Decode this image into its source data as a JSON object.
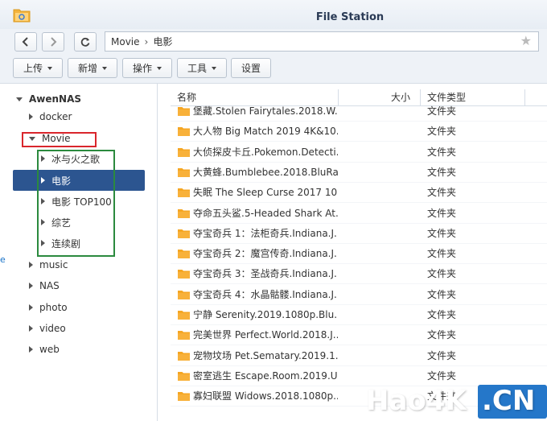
{
  "window": {
    "title": "File Station"
  },
  "nav": {
    "path": [
      "Movie",
      "电影"
    ]
  },
  "toolbar": {
    "upload": "上传",
    "create": "新增",
    "action": "操作",
    "tools": "工具",
    "settings": "设置"
  },
  "tree": {
    "root": "AwenNAS",
    "items": [
      {
        "label": "docker",
        "level": 1,
        "expanded": false
      },
      {
        "label": "Movie",
        "level": 1,
        "expanded": true
      },
      {
        "label": "冰与火之歌",
        "level": 2,
        "expanded": false
      },
      {
        "label": "电影",
        "level": 2,
        "expanded": false,
        "selected": true
      },
      {
        "label": "电影 TOP100",
        "level": 2,
        "expanded": false
      },
      {
        "label": "综艺",
        "level": 2,
        "expanded": false
      },
      {
        "label": "连续剧",
        "level": 2,
        "expanded": false
      },
      {
        "label": "music",
        "level": 1,
        "expanded": false
      },
      {
        "label": "NAS",
        "level": 1,
        "expanded": false
      },
      {
        "label": "photo",
        "level": 1,
        "expanded": false
      },
      {
        "label": "video",
        "level": 1,
        "expanded": false
      },
      {
        "label": "web",
        "level": 1,
        "expanded": false
      }
    ]
  },
  "files": {
    "columns": {
      "name": "名称",
      "size": "大小",
      "type": "文件类型"
    },
    "rows": [
      {
        "name": "堡藏.Stolen Fairytales.2018.W...",
        "type": "文件夹"
      },
      {
        "name": "大人物 Big Match 2019 4K&10...",
        "type": "文件夹"
      },
      {
        "name": "大侦探皮卡丘.Pokemon.Detecti...",
        "type": "文件夹"
      },
      {
        "name": "大黄蜂.Bumblebee.2018.BluRa...",
        "type": "文件夹"
      },
      {
        "name": "失眠 The Sleep Curse 2017 10...",
        "type": "文件夹"
      },
      {
        "name": "夺命五头鲨.5-Headed Shark At...",
        "type": "文件夹"
      },
      {
        "name": "夺宝奇兵 1：法柜奇兵.Indiana.J...",
        "type": "文件夹"
      },
      {
        "name": "夺宝奇兵 2：魔宫传奇.Indiana.J...",
        "type": "文件夹"
      },
      {
        "name": "夺宝奇兵 3：圣战奇兵.Indiana.J...",
        "type": "文件夹"
      },
      {
        "name": "夺宝奇兵 4：水晶骷髅.Indiana.J...",
        "type": "文件夹"
      },
      {
        "name": "宁静 Serenity.2019.1080p.Blu...",
        "type": "文件夹"
      },
      {
        "name": "完美世界 Perfect.World.2018.J...",
        "type": "文件夹"
      },
      {
        "name": "宠物坟场 Pet.Sematary.2019.1...",
        "type": "文件夹"
      },
      {
        "name": "密室逃生 Escape.Room.2019.U...",
        "type": "文件夹"
      },
      {
        "name": "寡妇联盟 Widows.2018.1080p...",
        "type": "文件夹"
      }
    ]
  },
  "edge": {
    "left_char": "e"
  },
  "watermark": {
    "brand": "Hao4K",
    "tld": ".CN"
  },
  "colors": {
    "selected": "#2c5590",
    "folder": "#f5a623",
    "highlight_red": "#d9262c",
    "highlight_green": "#2b8a3e"
  }
}
